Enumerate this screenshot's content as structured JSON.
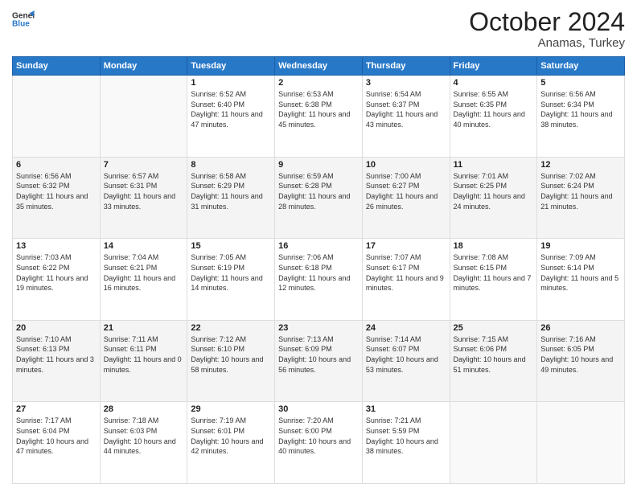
{
  "header": {
    "logo_line1": "General",
    "logo_line2": "Blue",
    "month": "October 2024",
    "location": "Anamas, Turkey"
  },
  "weekdays": [
    "Sunday",
    "Monday",
    "Tuesday",
    "Wednesday",
    "Thursday",
    "Friday",
    "Saturday"
  ],
  "weeks": [
    [
      {
        "day": "",
        "info": ""
      },
      {
        "day": "",
        "info": ""
      },
      {
        "day": "1",
        "info": "Sunrise: 6:52 AM\nSunset: 6:40 PM\nDaylight: 11 hours and 47 minutes."
      },
      {
        "day": "2",
        "info": "Sunrise: 6:53 AM\nSunset: 6:38 PM\nDaylight: 11 hours and 45 minutes."
      },
      {
        "day": "3",
        "info": "Sunrise: 6:54 AM\nSunset: 6:37 PM\nDaylight: 11 hours and 43 minutes."
      },
      {
        "day": "4",
        "info": "Sunrise: 6:55 AM\nSunset: 6:35 PM\nDaylight: 11 hours and 40 minutes."
      },
      {
        "day": "5",
        "info": "Sunrise: 6:56 AM\nSunset: 6:34 PM\nDaylight: 11 hours and 38 minutes."
      }
    ],
    [
      {
        "day": "6",
        "info": "Sunrise: 6:56 AM\nSunset: 6:32 PM\nDaylight: 11 hours and 35 minutes."
      },
      {
        "day": "7",
        "info": "Sunrise: 6:57 AM\nSunset: 6:31 PM\nDaylight: 11 hours and 33 minutes."
      },
      {
        "day": "8",
        "info": "Sunrise: 6:58 AM\nSunset: 6:29 PM\nDaylight: 11 hours and 31 minutes."
      },
      {
        "day": "9",
        "info": "Sunrise: 6:59 AM\nSunset: 6:28 PM\nDaylight: 11 hours and 28 minutes."
      },
      {
        "day": "10",
        "info": "Sunrise: 7:00 AM\nSunset: 6:27 PM\nDaylight: 11 hours and 26 minutes."
      },
      {
        "day": "11",
        "info": "Sunrise: 7:01 AM\nSunset: 6:25 PM\nDaylight: 11 hours and 24 minutes."
      },
      {
        "day": "12",
        "info": "Sunrise: 7:02 AM\nSunset: 6:24 PM\nDaylight: 11 hours and 21 minutes."
      }
    ],
    [
      {
        "day": "13",
        "info": "Sunrise: 7:03 AM\nSunset: 6:22 PM\nDaylight: 11 hours and 19 minutes."
      },
      {
        "day": "14",
        "info": "Sunrise: 7:04 AM\nSunset: 6:21 PM\nDaylight: 11 hours and 16 minutes."
      },
      {
        "day": "15",
        "info": "Sunrise: 7:05 AM\nSunset: 6:19 PM\nDaylight: 11 hours and 14 minutes."
      },
      {
        "day": "16",
        "info": "Sunrise: 7:06 AM\nSunset: 6:18 PM\nDaylight: 11 hours and 12 minutes."
      },
      {
        "day": "17",
        "info": "Sunrise: 7:07 AM\nSunset: 6:17 PM\nDaylight: 11 hours and 9 minutes."
      },
      {
        "day": "18",
        "info": "Sunrise: 7:08 AM\nSunset: 6:15 PM\nDaylight: 11 hours and 7 minutes."
      },
      {
        "day": "19",
        "info": "Sunrise: 7:09 AM\nSunset: 6:14 PM\nDaylight: 11 hours and 5 minutes."
      }
    ],
    [
      {
        "day": "20",
        "info": "Sunrise: 7:10 AM\nSunset: 6:13 PM\nDaylight: 11 hours and 3 minutes."
      },
      {
        "day": "21",
        "info": "Sunrise: 7:11 AM\nSunset: 6:11 PM\nDaylight: 11 hours and 0 minutes."
      },
      {
        "day": "22",
        "info": "Sunrise: 7:12 AM\nSunset: 6:10 PM\nDaylight: 10 hours and 58 minutes."
      },
      {
        "day": "23",
        "info": "Sunrise: 7:13 AM\nSunset: 6:09 PM\nDaylight: 10 hours and 56 minutes."
      },
      {
        "day": "24",
        "info": "Sunrise: 7:14 AM\nSunset: 6:07 PM\nDaylight: 10 hours and 53 minutes."
      },
      {
        "day": "25",
        "info": "Sunrise: 7:15 AM\nSunset: 6:06 PM\nDaylight: 10 hours and 51 minutes."
      },
      {
        "day": "26",
        "info": "Sunrise: 7:16 AM\nSunset: 6:05 PM\nDaylight: 10 hours and 49 minutes."
      }
    ],
    [
      {
        "day": "27",
        "info": "Sunrise: 7:17 AM\nSunset: 6:04 PM\nDaylight: 10 hours and 47 minutes."
      },
      {
        "day": "28",
        "info": "Sunrise: 7:18 AM\nSunset: 6:03 PM\nDaylight: 10 hours and 44 minutes."
      },
      {
        "day": "29",
        "info": "Sunrise: 7:19 AM\nSunset: 6:01 PM\nDaylight: 10 hours and 42 minutes."
      },
      {
        "day": "30",
        "info": "Sunrise: 7:20 AM\nSunset: 6:00 PM\nDaylight: 10 hours and 40 minutes."
      },
      {
        "day": "31",
        "info": "Sunrise: 7:21 AM\nSunset: 5:59 PM\nDaylight: 10 hours and 38 minutes."
      },
      {
        "day": "",
        "info": ""
      },
      {
        "day": "",
        "info": ""
      }
    ]
  ]
}
